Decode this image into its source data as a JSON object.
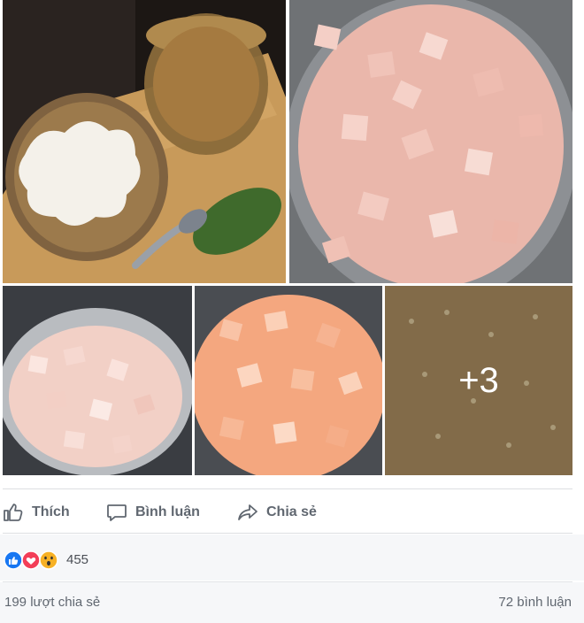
{
  "photos": {
    "more_count": "+3"
  },
  "actions": {
    "like": "Thích",
    "comment": "Bình luận",
    "share": "Chia sẻ"
  },
  "reactions": {
    "count": "455",
    "icons": [
      "like-icon",
      "love-icon",
      "wow-icon"
    ]
  },
  "stats": {
    "shares": "199 lượt chia sẻ",
    "comments": "72 bình luận"
  },
  "colors": {
    "like_blue": "#1877f2",
    "love_red": "#f33e58",
    "wow_yellow": "#f7b125",
    "text_grey": "#606770"
  }
}
